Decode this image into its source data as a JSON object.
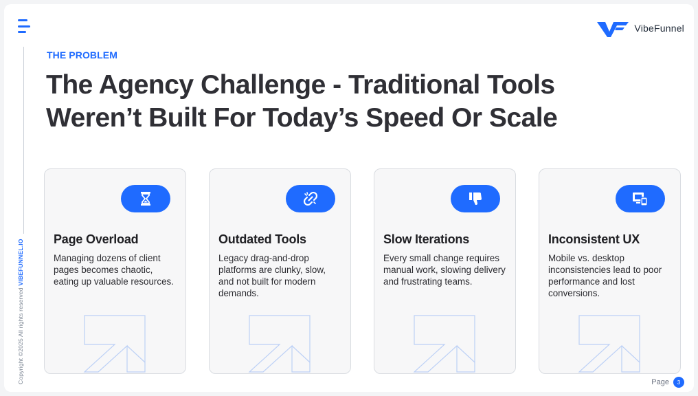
{
  "brand": {
    "name": "VibeFunnel",
    "accent": "#1f6bff"
  },
  "side": {
    "copyright": "Copyright ©2025 All rights reserved",
    "site": "VIBEFUNNEL.IO"
  },
  "header": {
    "kicker": "THE PROBLEM",
    "title": "The Agency Challenge - Traditional Tools Weren’t Built For Today’s Speed Or Scale"
  },
  "cards": [
    {
      "icon": "hourglass-icon",
      "title": "Page Overload",
      "description": "Managing dozens of client pages becomes chaotic, eating up valuable resources."
    },
    {
      "icon": "broken-link-icon",
      "title": "Outdated Tools",
      "description": "Legacy drag-and-drop platforms are clunky, slow, and not built for modern demands."
    },
    {
      "icon": "thumbs-down-icon",
      "title": "Slow Iterations",
      "description": "Every small change requires manual work, slowing delivery and frustrating teams."
    },
    {
      "icon": "responsive-devices-icon",
      "title": "Inconsistent UX",
      "description": "Mobile vs. desktop inconsistencies lead to poor performance and lost conversions."
    }
  ],
  "footer": {
    "page_label": "Page",
    "page_number": "3"
  }
}
